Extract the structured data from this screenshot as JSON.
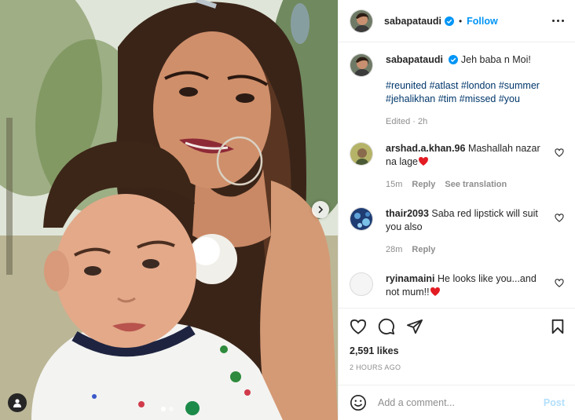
{
  "post": {
    "username": "sabapataudi",
    "follow_label": "Follow",
    "separator": "•",
    "caption_text": "Jeh baba n Moi!",
    "hashtags": "#reunited #atlast #london #summer #jehalikhan #tim #missed #you",
    "edited": "Edited · 2h"
  },
  "comments": [
    {
      "username": "arshad.a.khan.96",
      "text": "Mashallah nazar na lage",
      "emoji": "red-heart",
      "time": "15m",
      "reply": "Reply",
      "translate": "See translation"
    },
    {
      "username": "thair2093",
      "text": "Saba red lipstick will suit you also",
      "time": "28m",
      "reply": "Reply"
    },
    {
      "username": "ryinamaini",
      "text": "He looks like you...and not mum!!",
      "emoji": "red-heart"
    }
  ],
  "actions": {
    "likes": "2,591 likes",
    "time_ago": "2 HOURS AGO"
  },
  "add_comment": {
    "placeholder": "Add a comment...",
    "post_label": "Post"
  },
  "carousel": {
    "slides": 2,
    "active": 1
  },
  "colors": {
    "accent": "#0095f6",
    "text": "#262626",
    "muted": "#8e8e8e",
    "heart": "#ed4956",
    "hashtag": "#00376b"
  },
  "icons": [
    "verified-badge-icon",
    "more-options-icon",
    "like-icon",
    "comment-icon",
    "share-icon",
    "bookmark-icon",
    "emoji-icon",
    "chevron-right-icon",
    "user-tag-icon"
  ]
}
